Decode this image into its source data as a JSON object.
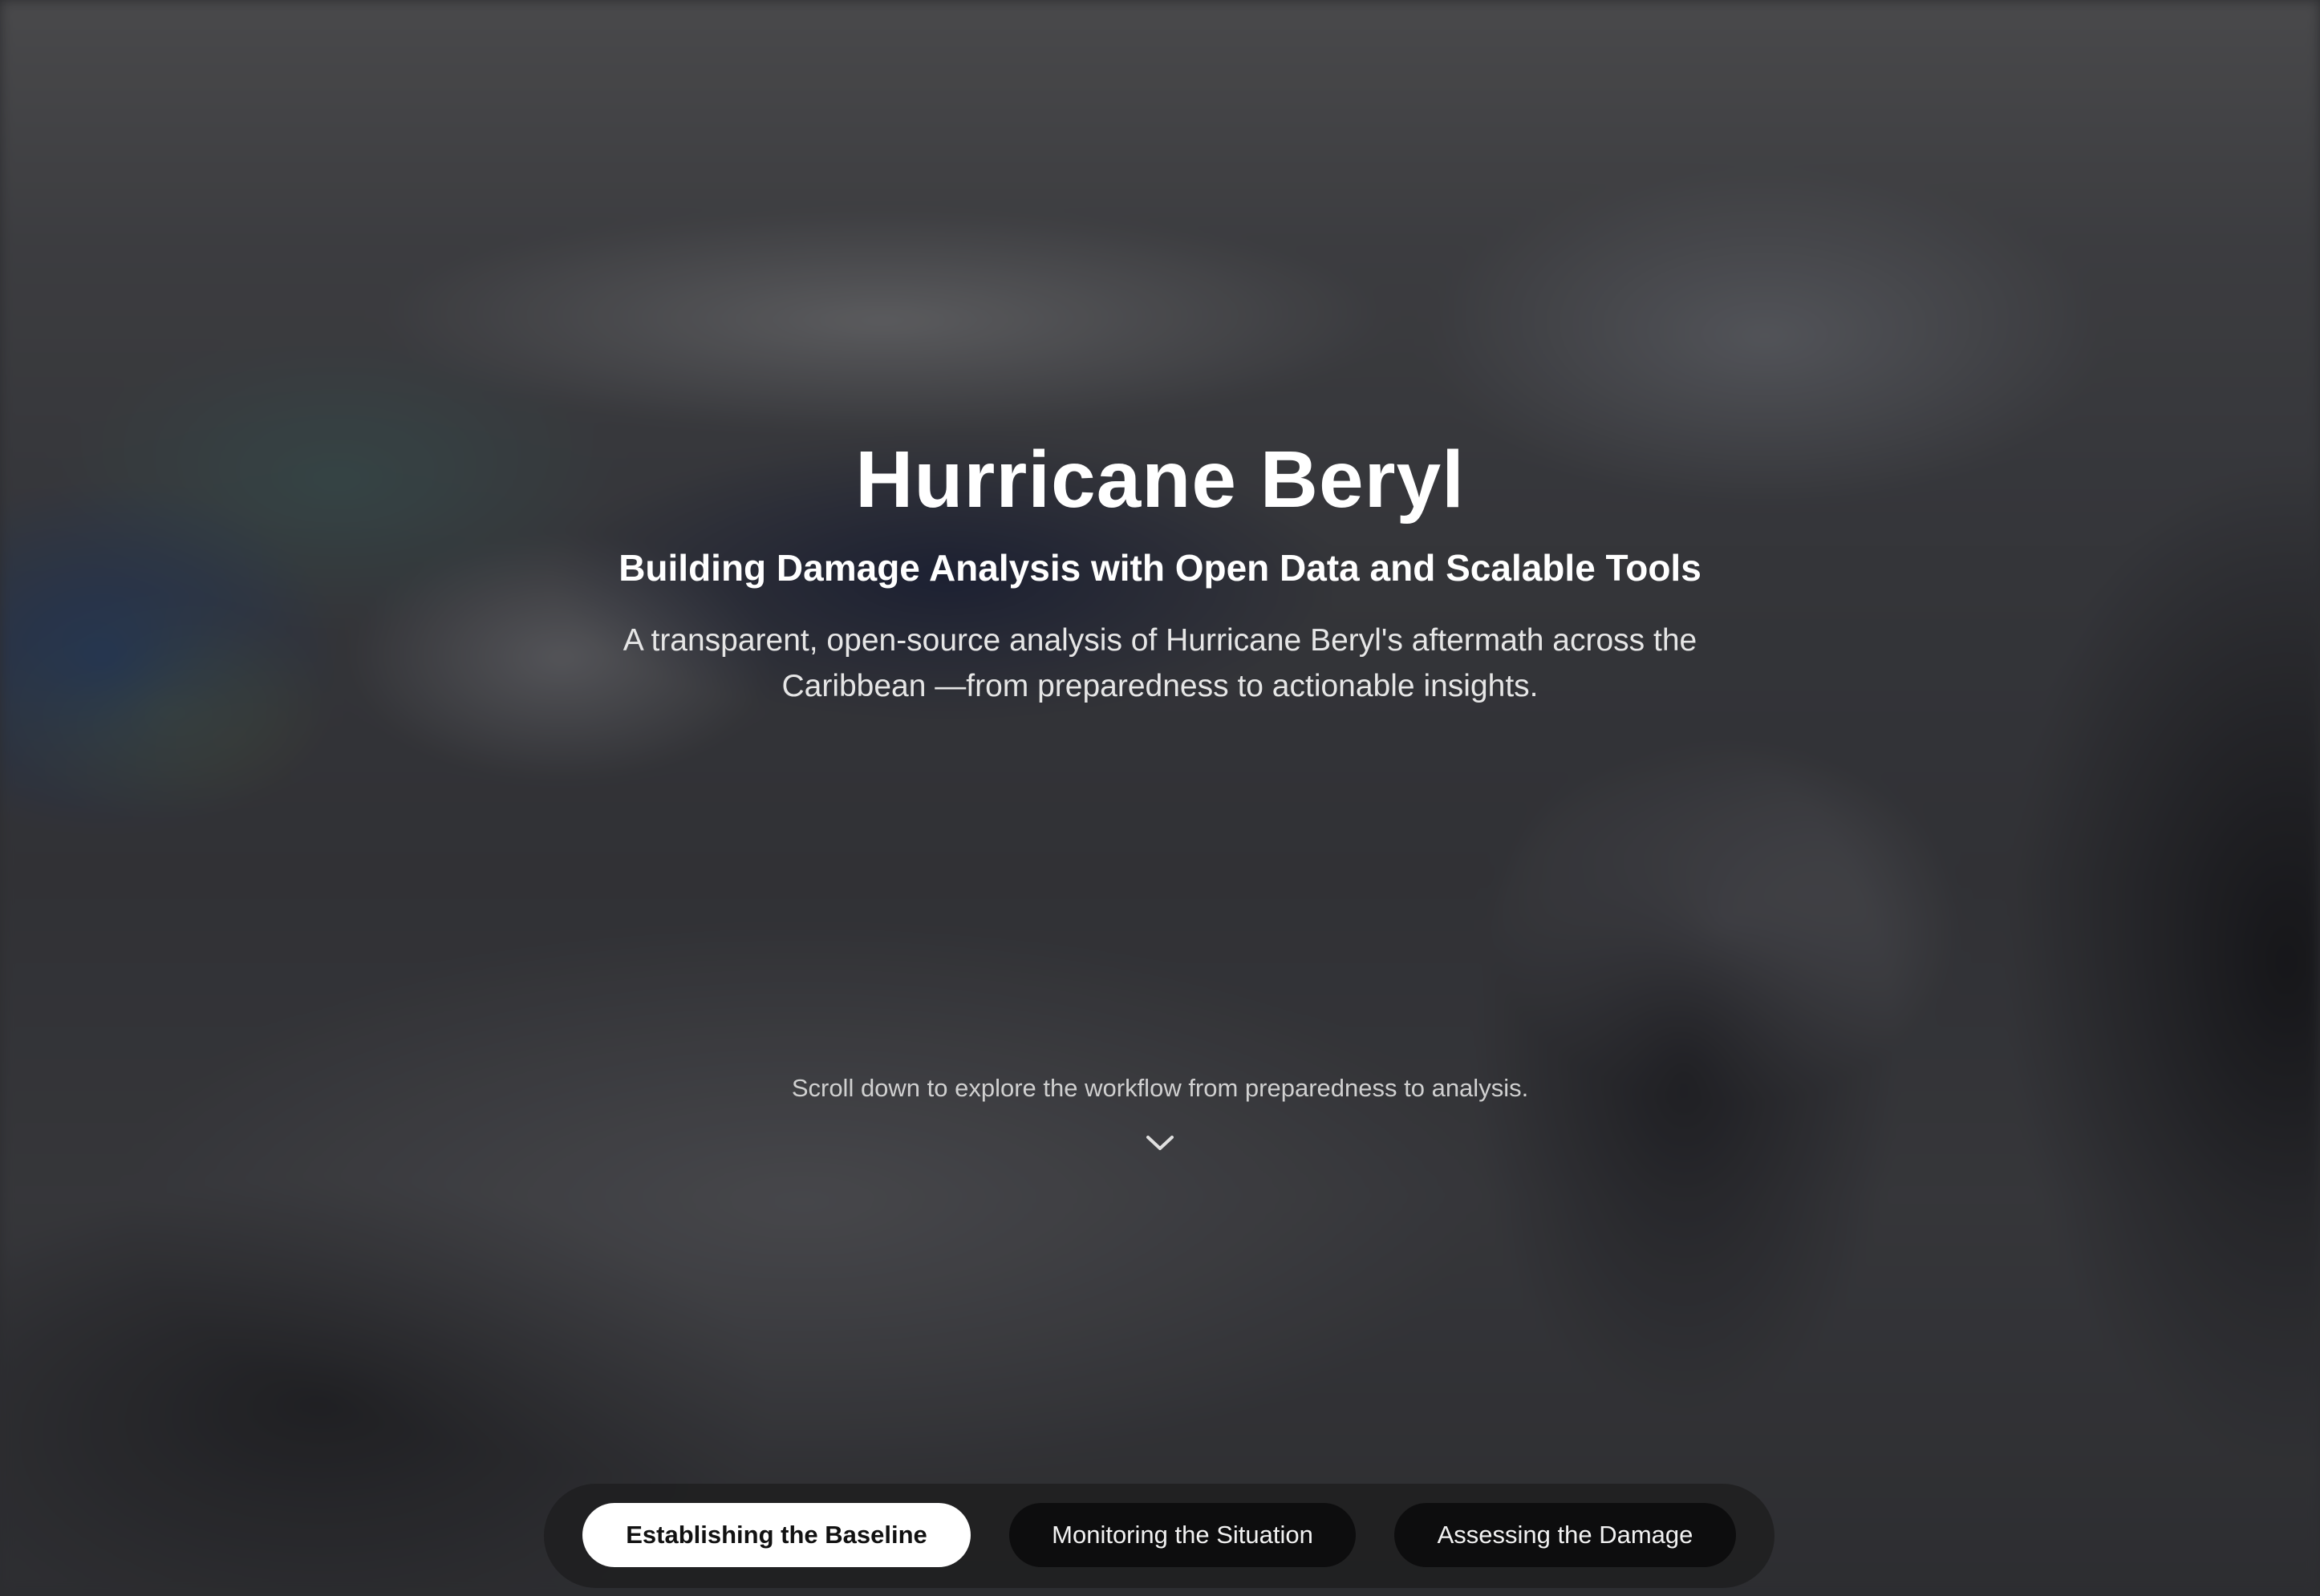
{
  "hero": {
    "title": "Hurricane Beryl",
    "subtitle": "Building Damage Analysis with Open Data and Scalable Tools",
    "description": "A transparent, open-source analysis of Hurricane Beryl's aftermath across the Caribbean —from preparedness to actionable insights.",
    "scroll_hint": "Scroll down to explore the workflow from preparedness to analysis.",
    "scroll_icon": "chevron-down-icon"
  },
  "nav": {
    "tabs": [
      {
        "label": "Establishing the Baseline",
        "active": true
      },
      {
        "label": "Monitoring the Situation",
        "active": false
      },
      {
        "label": "Assessing the Damage",
        "active": false
      }
    ]
  },
  "colors": {
    "active_tab_bg": "#ffffff",
    "active_tab_text": "#111111",
    "inactive_tab_bg": "#0d0d0e",
    "inactive_tab_text": "#f2f2f2",
    "title_text": "#ffffff"
  }
}
